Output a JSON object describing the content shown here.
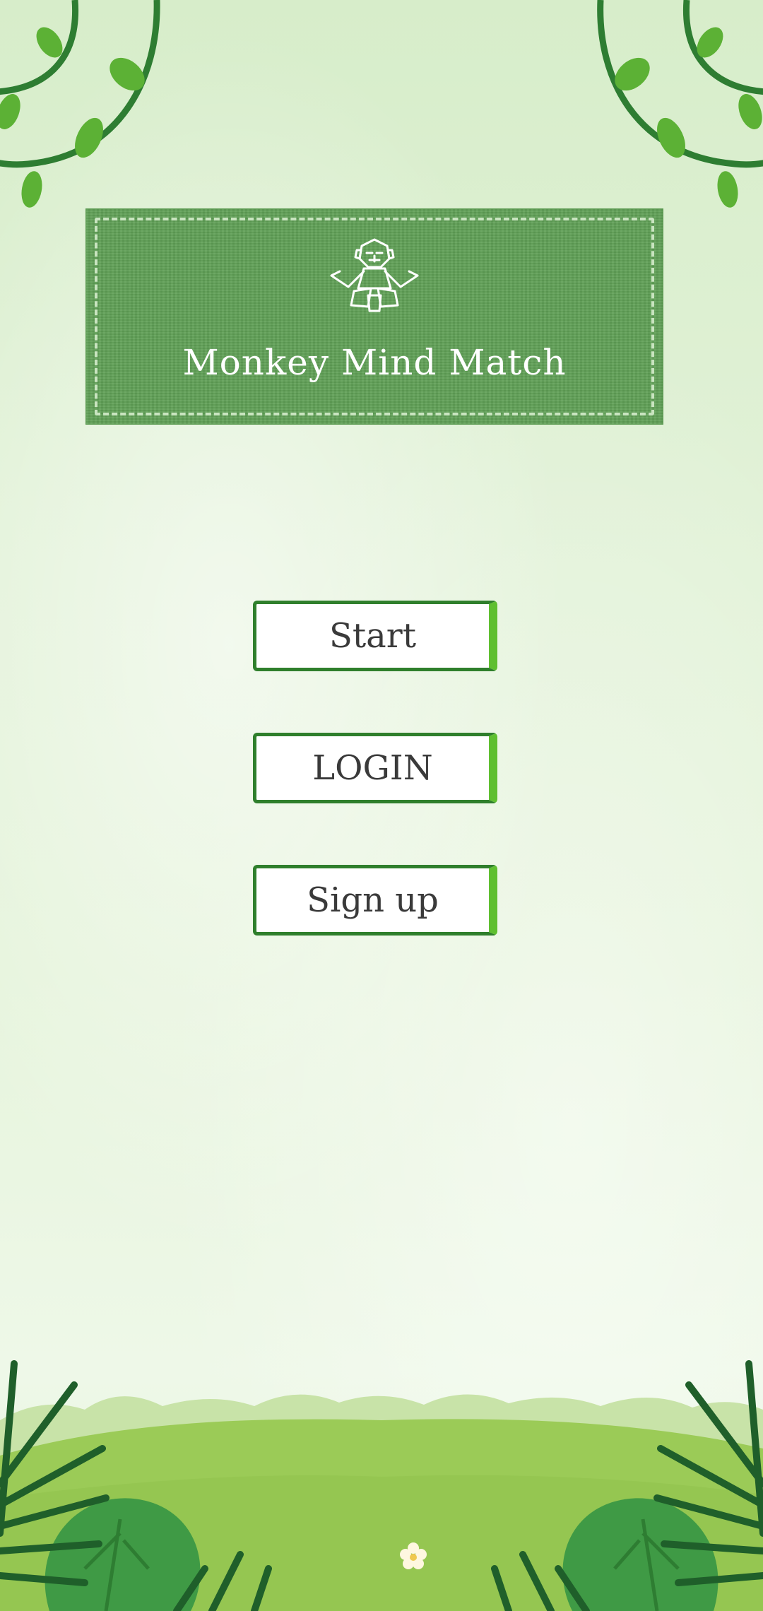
{
  "app": {
    "title": "Monkey Mind Match"
  },
  "menu": {
    "start_label": "Start",
    "login_label": "LOGIN",
    "signup_label": "Sign up"
  },
  "icons": {
    "logo": "monkey-logo-icon",
    "decor_top_left": "vine-icon",
    "decor_top_right": "vine-icon",
    "decor_bottom": "jungle-grass-icon"
  },
  "colors": {
    "banner": "#5f9f55",
    "button_border": "#2f7f2c",
    "button_accent": "#5fbf30",
    "vine": "#2e7d32",
    "leaf": "#5cb135"
  }
}
